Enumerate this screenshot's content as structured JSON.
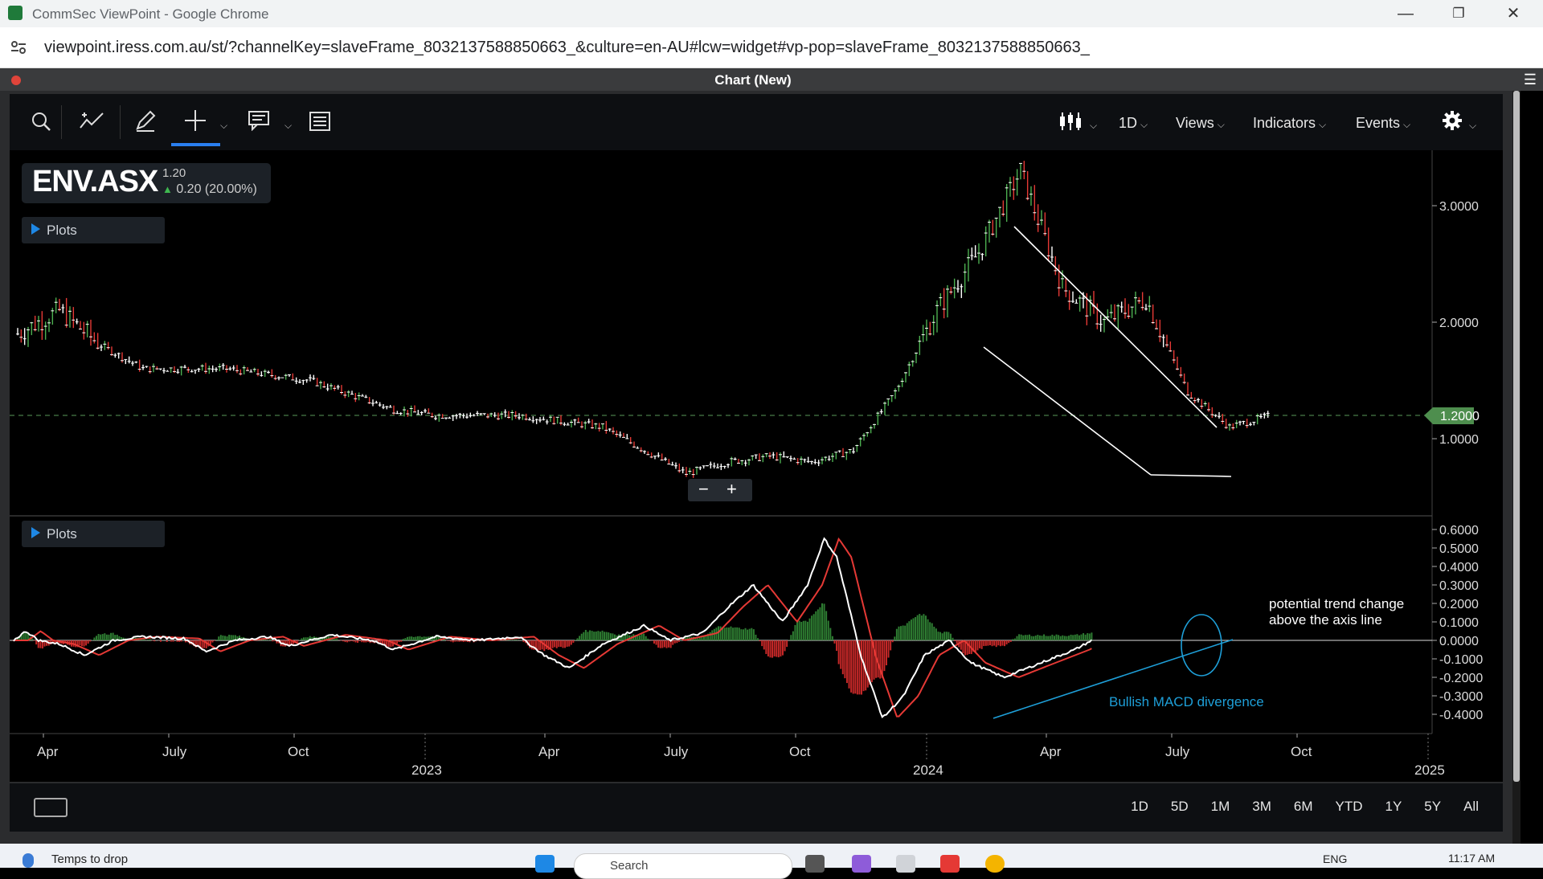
{
  "window": {
    "title": "CommSec ViewPoint - Google Chrome",
    "min": "—",
    "restore": "❐",
    "close": "✕"
  },
  "browser": {
    "url": "viewpoint.iress.com.au/st/?channelKey=slaveFrame_8032137588850663_&culture=en-AU#lcw=widget#vp-pop=slaveFrame_8032137588850663_"
  },
  "panel": {
    "title": "Chart (New)",
    "menu_icon": "hamburger-icon"
  },
  "toolbar": {
    "interval": "1D",
    "views": "Views",
    "indicators": "Indicators",
    "events": "Events",
    "icons": [
      "search-icon",
      "draw-line-icon",
      "pencil-icon",
      "crosshair-icon",
      "comment-icon",
      "list-icon",
      "candles-icon",
      "gear-icon"
    ]
  },
  "ticker": {
    "symbol": "ENV.ASX",
    "last": "1.20",
    "change": "0.20 (20.00%)",
    "up_arrow": "▲"
  },
  "plots_label": "Plots",
  "zoom": {
    "minus": "−",
    "plus": "+"
  },
  "bottombar": {
    "ranges": [
      "1D",
      "5D",
      "1M",
      "3M",
      "6M",
      "YTD",
      "1Y",
      "5Y",
      "All"
    ]
  },
  "taskbar": {
    "temp": "Temps to drop",
    "search": "Search",
    "lang": "ENG",
    "time": "11:17 AM"
  },
  "chart_data": [
    {
      "type": "candlestick",
      "symbol": "ENV.ASX",
      "x_ticks": [
        "Apr",
        "July",
        "Oct",
        "Apr",
        "July",
        "Oct",
        "Apr",
        "July",
        "Oct"
      ],
      "year_ticks": [
        "2023",
        "2024",
        "2025"
      ],
      "y_ticks": [
        "3.0000",
        "2.0000",
        "1.0000"
      ],
      "last_price_label": "1.2000",
      "colors": {
        "up": "#4caf50",
        "down": "#e53935",
        "flat": "#ffffff",
        "last_line": "#5a9a5a"
      },
      "approx_price_path": [
        {
          "t": "2022-03",
          "close": 1.9
        },
        {
          "t": "2022-04",
          "close": 2.1
        },
        {
          "t": "2022-05",
          "close": 1.8
        },
        {
          "t": "2022-06",
          "close": 1.6
        },
        {
          "t": "2022-08",
          "close": 1.6
        },
        {
          "t": "2022-10",
          "close": 1.5
        },
        {
          "t": "2022-12",
          "close": 1.25
        },
        {
          "t": "2023-01",
          "close": 1.2
        },
        {
          "t": "2023-03",
          "close": 1.2
        },
        {
          "t": "2023-05",
          "close": 1.1
        },
        {
          "t": "2023-07",
          "close": 0.7
        },
        {
          "t": "2023-08",
          "close": 0.8
        },
        {
          "t": "2023-09",
          "close": 0.85
        },
        {
          "t": "2023-10",
          "close": 0.8
        },
        {
          "t": "2023-11",
          "close": 0.9
        },
        {
          "t": "2023-12",
          "close": 1.4
        },
        {
          "t": "2024-01",
          "close": 2.1
        },
        {
          "t": "2024-02",
          "close": 2.6
        },
        {
          "t": "2024-03",
          "close": 3.3
        },
        {
          "t": "2024-04",
          "close": 2.3
        },
        {
          "t": "2024-05",
          "close": 2.0
        },
        {
          "t": "2024-06",
          "close": 2.2
        },
        {
          "t": "2024-07",
          "close": 1.4
        },
        {
          "t": "2024-08",
          "close": 1.1
        },
        {
          "t": "2024-09",
          "close": 1.2
        }
      ]
    },
    {
      "type": "macd",
      "y_ticks": [
        "0.6000",
        "0.5000",
        "0.4000",
        "0.3000",
        "0.2000",
        "0.1000",
        "0.0000",
        "-0.1000",
        "-0.2000",
        "-0.3000",
        "-0.4000"
      ],
      "annotations": [
        "potential trend change",
        "above the axis line",
        "Bullish MACD divergence"
      ],
      "colors": {
        "macd": "#ffffff",
        "signal": "#e53935",
        "hist_pos": "#2e7d32",
        "hist_neg": "#c62828",
        "annotation": "#1e9fd8"
      }
    }
  ]
}
